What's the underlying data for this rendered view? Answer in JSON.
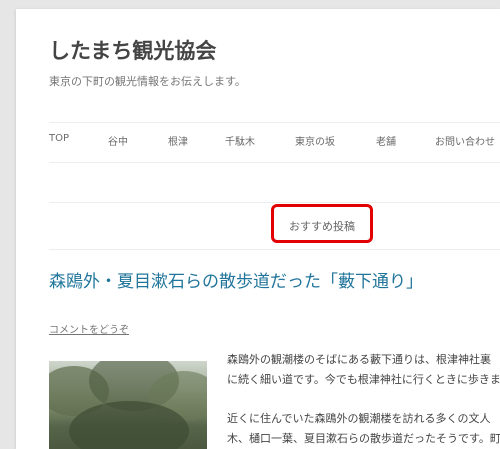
{
  "site": {
    "title": "したまち観光協会",
    "description": "東京の下町の観光情報をお伝えします。"
  },
  "nav": {
    "items": [
      {
        "label": "TOP"
      },
      {
        "label": "谷中"
      },
      {
        "label": "根津"
      },
      {
        "label": "千駄木"
      },
      {
        "label": "東京の坂"
      },
      {
        "label": "老舗"
      },
      {
        "label": "お問い合わせ"
      }
    ]
  },
  "widget": {
    "title": "おすすめ投稿",
    "highlight_color": "#e30000"
  },
  "post": {
    "title": "森鴎外・夏目漱石らの散歩道だった「藪下通り」",
    "comment_link": "コメントをどうぞ",
    "paragraphs": [
      "森鴎外の観潮楼のそばにある藪下通りは、根津神社裏",
      "に続く細い道です。今でも根津神社に行くときに歩きま",
      "近くに住んでいた森鴎外の観潮楼を訪れる多くの文人",
      "木、樋口一葉、夏目漱石らの散歩道だったそうです。町"
    ]
  },
  "colors": {
    "link": "#21759b",
    "text": "#444444",
    "background": "#e6e6e6"
  }
}
